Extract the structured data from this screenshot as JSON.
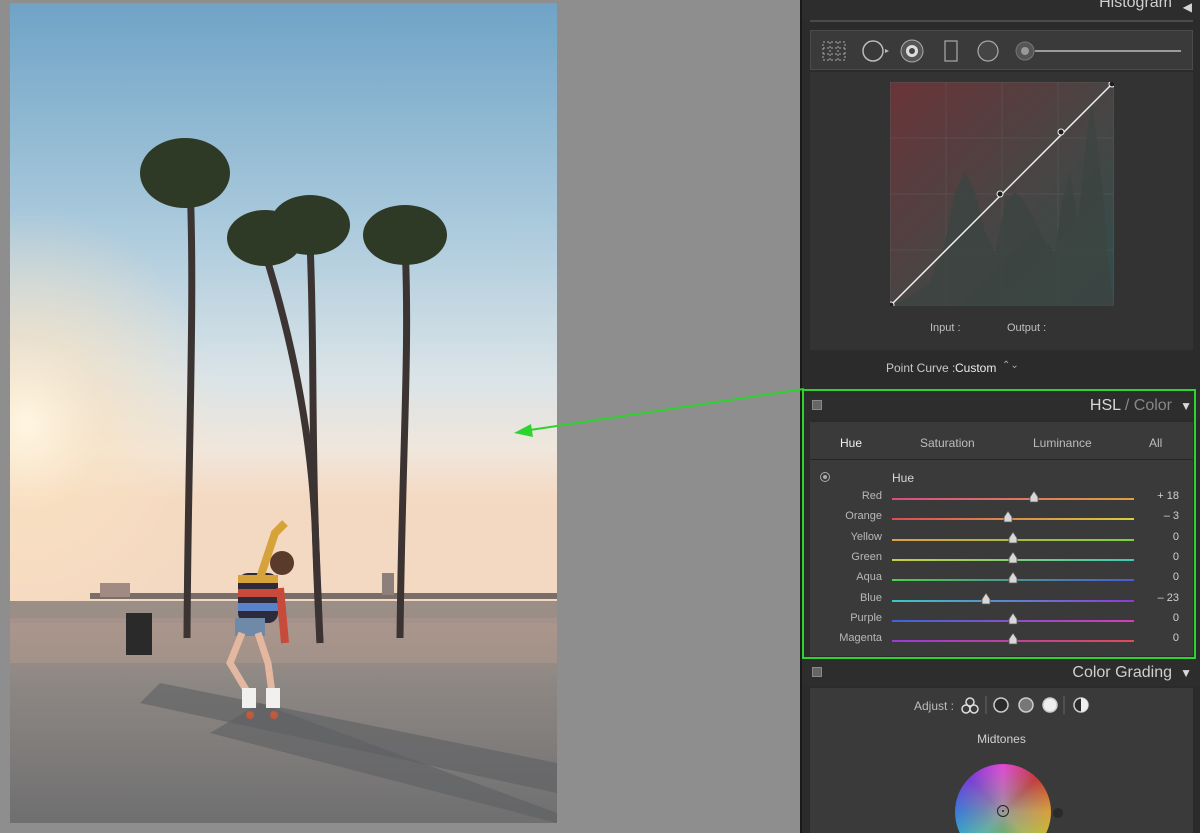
{
  "histogram_panel": {
    "title": "Histogram",
    "collapse_icon": "triangle-left-icon"
  },
  "tone_curve": {
    "tools": [
      "grid-icon",
      "target-adjust-icon",
      "parametric-curve-icon",
      "rect-curve-icon",
      "point-curve-icon",
      "slider-knob-icon"
    ],
    "input_label": "Input :",
    "output_label": "Output :",
    "point_curve_label": "Point Curve :",
    "point_curve_value": "Custom",
    "point_curve_arrow": "⌃⌄"
  },
  "hsl_panel": {
    "title_a": "HSL",
    "title_sep": " / ",
    "title_b": "Color",
    "collapse_icon": "triangle-down-icon",
    "tabs": [
      "Hue",
      "Saturation",
      "Luminance",
      "All"
    ],
    "active_tab": "Hue",
    "section_label": "Hue",
    "sliders": [
      {
        "name": "Red",
        "value": "+ 18",
        "level": 0.585,
        "color_from": "#d94b86",
        "color_to": "#e0a040"
      },
      {
        "name": "Orange",
        "value": "– 3",
        "level": 0.48,
        "color_from": "#df4a55",
        "color_to": "#d8d03a"
      },
      {
        "name": "Yellow",
        "value": "0",
        "level": 0.5,
        "color_from": "#e0a040",
        "color_to": "#7bd23a"
      },
      {
        "name": "Green",
        "value": "0",
        "level": 0.5,
        "color_from": "#c9d03a",
        "color_to": "#3ac9b7"
      },
      {
        "name": "Aqua",
        "value": "0",
        "level": 0.5,
        "color_from": "#4dd04a",
        "color_to": "#4a5ad8"
      },
      {
        "name": "Blue",
        "value": "– 23",
        "level": 0.39,
        "color_from": "#3ac9c2",
        "color_to": "#8a3ad8"
      },
      {
        "name": "Purple",
        "value": "0",
        "level": 0.5,
        "color_from": "#3a66d8",
        "color_to": "#d83ab8"
      },
      {
        "name": "Magenta",
        "value": "0",
        "level": 0.5,
        "color_from": "#9a3ad8",
        "color_to": "#e04a5a"
      }
    ]
  },
  "color_grading_panel": {
    "title": "Color Grading",
    "collapse_icon": "triangle-down-icon",
    "adjust_label": "Adjust :",
    "adjust_icons": [
      "three-way-icon",
      "shadows-circle-icon",
      "midtones-circle-icon",
      "highlights-circle-icon",
      "global-circle-icon"
    ],
    "wheel_label": "Midtones"
  },
  "annotation": {
    "highlight_color": "#2dd42d"
  }
}
